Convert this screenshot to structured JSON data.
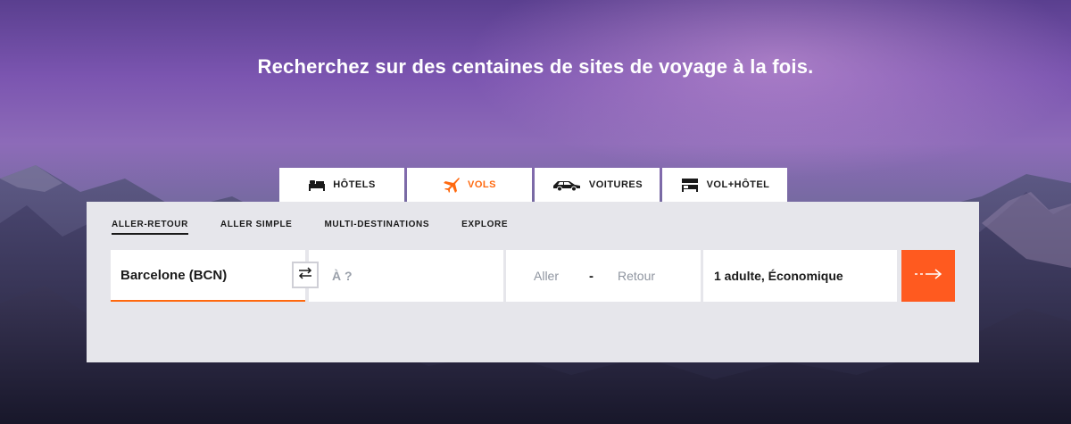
{
  "headline": "Recherchez sur des centaines de sites de voyage à la fois.",
  "tabs": [
    {
      "label": "HÔTELS",
      "icon": "bed-icon",
      "active": false
    },
    {
      "label": "VOLS",
      "icon": "plane-icon",
      "active": true
    },
    {
      "label": "VOITURES",
      "icon": "car-icon",
      "active": false
    },
    {
      "label": "VOL+HÔTEL",
      "icon": "flight-hotel-icon",
      "active": false
    }
  ],
  "trip_types": [
    {
      "label": "ALLER-RETOUR",
      "active": true
    },
    {
      "label": "ALLER SIMPLE",
      "active": false
    },
    {
      "label": "MULTI-DESTINATIONS",
      "active": false
    },
    {
      "label": "EXPLORE",
      "active": false
    }
  ],
  "search": {
    "origin": "Barcelone (BCN)",
    "destination_placeholder": "À ?",
    "depart_placeholder": "Aller",
    "date_separator": "-",
    "return_placeholder": "Retour",
    "travelers": "1 adulte, Économique",
    "swap_icon": "swap-arrows-icon",
    "submit_icon": "arrow-right-icon"
  },
  "colors": {
    "accent": "#ff690f",
    "submit": "#ff5a1f",
    "panel": "#e6e6eb"
  }
}
